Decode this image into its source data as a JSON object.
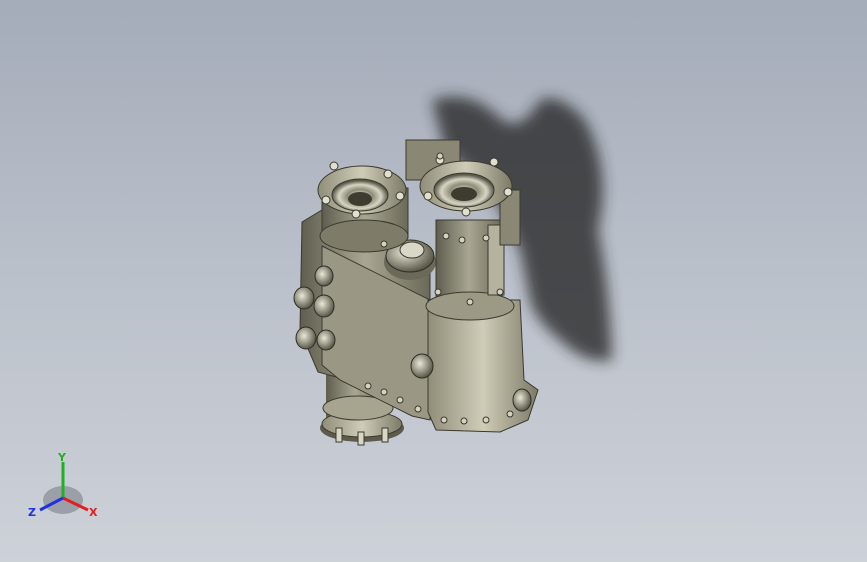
{
  "viewport": {
    "background_top": "#a4acb9",
    "background_bottom": "#cdd1d8",
    "model_color": "#8c8a77",
    "shadow_color": "#222222"
  },
  "triad": {
    "x_label": "X",
    "y_label": "Y",
    "z_label": "Z",
    "x_color": "#e02020",
    "y_color": "#20b020",
    "z_color": "#2030e0"
  }
}
